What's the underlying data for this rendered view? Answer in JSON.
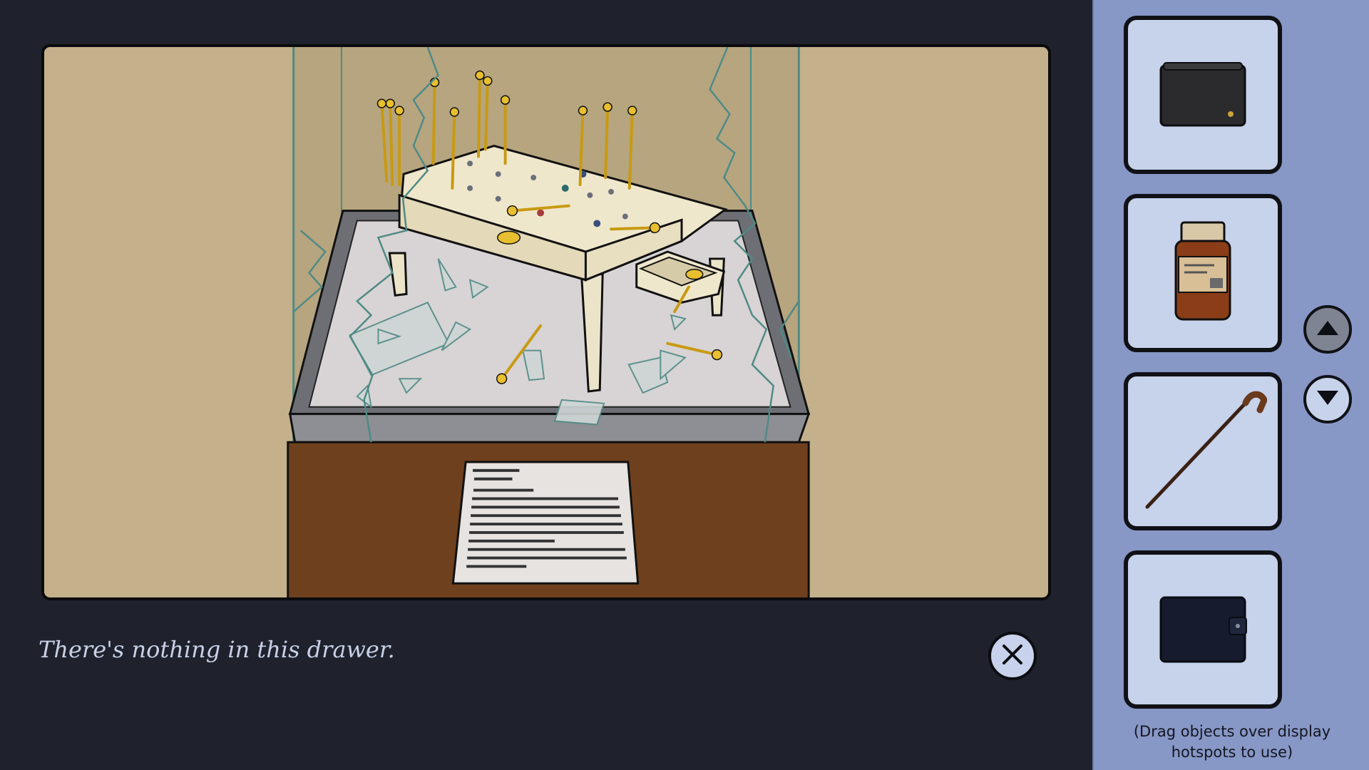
{
  "dialogue": {
    "message": "There's nothing in this drawer."
  },
  "controls": {
    "close_icon": "close-x-icon",
    "scroll_up_icon": "triangle-up-icon",
    "scroll_down_icon": "triangle-down-icon"
  },
  "inventory": {
    "items": [
      {
        "name": "black-wallet",
        "icon": "wallet-icon"
      },
      {
        "name": "medicine-bottle",
        "icon": "pill-bottle-icon"
      },
      {
        "name": "walking-cane",
        "icon": "cane-icon"
      },
      {
        "name": "navy-wallet",
        "icon": "wallet-clasp-icon"
      }
    ],
    "hint": "(Drag objects over display hotspots to use)"
  },
  "scene": {
    "description_label": "museum-display-case-game-board"
  },
  "colors": {
    "background": "#1f222c",
    "sidebar": "#8797c6",
    "slot": "#c7d2eb",
    "wall": "#c4b08a",
    "pedestal": "#6f401e",
    "gold": "#e8bf2f"
  }
}
